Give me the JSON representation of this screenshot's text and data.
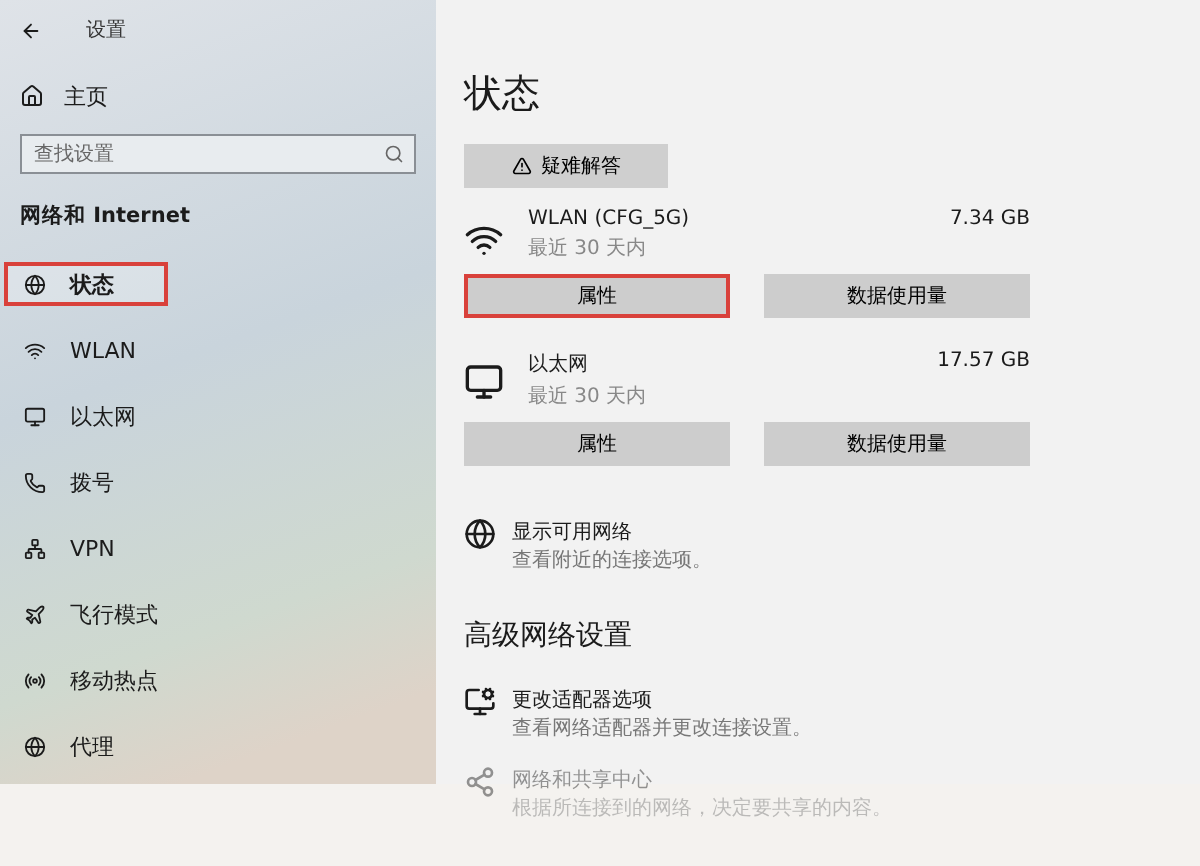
{
  "window": {
    "title": "设置"
  },
  "sidebar": {
    "home": "主页",
    "search": {
      "placeholder": "查找设置"
    },
    "section": "网络和 Internet",
    "items": [
      {
        "label": "状态",
        "selected": true,
        "highlighted": true
      },
      {
        "label": "WLAN",
        "selected": false,
        "highlighted": false
      },
      {
        "label": "以太网",
        "selected": false,
        "highlighted": false
      },
      {
        "label": "拨号",
        "selected": false,
        "highlighted": false
      },
      {
        "label": "VPN",
        "selected": false,
        "highlighted": false
      },
      {
        "label": "飞行模式",
        "selected": false,
        "highlighted": false
      },
      {
        "label": "移动热点",
        "selected": false,
        "highlighted": false
      },
      {
        "label": "代理",
        "selected": false,
        "highlighted": false
      }
    ]
  },
  "main": {
    "title": "状态",
    "troubleshoot": "疑难解答",
    "connections": [
      {
        "name": "WLAN (CFG_5G)",
        "period": "最近 30 天内",
        "usage": "7.34 GB",
        "buttons": [
          {
            "label": "属性",
            "highlighted": true
          },
          {
            "label": "数据使用量",
            "highlighted": false
          }
        ]
      },
      {
        "name": "以太网",
        "period": "最近 30 天内",
        "usage": "17.57 GB",
        "buttons": [
          {
            "label": "属性",
            "highlighted": false
          },
          {
            "label": "数据使用量",
            "highlighted": false
          }
        ]
      }
    ],
    "show_networks": {
      "title": "显示可用网络",
      "description": "查看附近的连接选项。"
    },
    "advanced_title": "高级网络设置",
    "advanced": [
      {
        "title": "更改适配器选项",
        "description": "查看网络适配器并更改连接设置。",
        "faded": false
      },
      {
        "title": "网络和共享中心",
        "description": "根据所连接到的网络，决定要共享的内容。",
        "faded": true
      }
    ]
  }
}
